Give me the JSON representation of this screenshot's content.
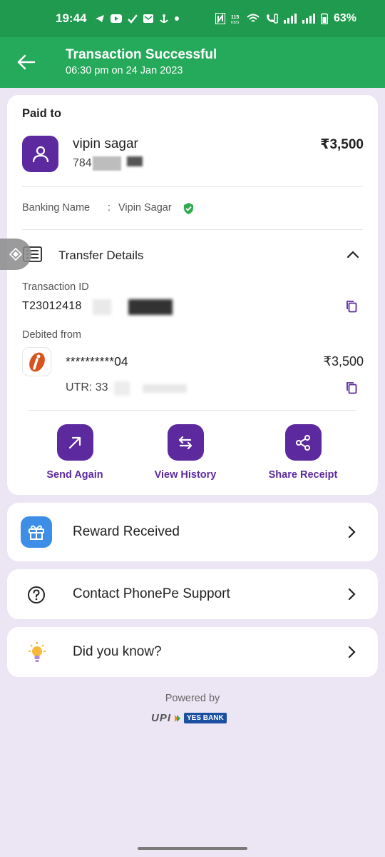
{
  "status_bar": {
    "time": "19:44",
    "battery": "63%",
    "speed": "115 KB/S"
  },
  "header": {
    "title": "Transaction Successful",
    "subtitle": "06:30 pm on 24 Jan 2023"
  },
  "payment": {
    "paid_to_label": "Paid to",
    "payee_name": "vipin sagar",
    "payee_phone": "784",
    "amount": "₹3,500",
    "banking_name_label": "Banking Name",
    "banking_name_sep": ":",
    "banking_name_value": "Vipin  Sagar"
  },
  "transfer": {
    "title": "Transfer Details",
    "txn_id_label": "Transaction ID",
    "txn_id_value": "T23012418",
    "debited_label": "Debited from",
    "account": "**********04",
    "debited_amount": "₹3,500",
    "utr": "UTR: 33"
  },
  "actions": [
    {
      "label": "Send Again"
    },
    {
      "label": "View History"
    },
    {
      "label": "Share Receipt"
    }
  ],
  "rows": [
    {
      "label": "Reward Received"
    },
    {
      "label": "Contact PhonePe Support"
    },
    {
      "label": "Did you know?"
    }
  ],
  "footer": {
    "powered_by": "Powered by",
    "upi": "UPI",
    "bank": "YES BANK"
  },
  "colors": {
    "primary": "#5c2a9e",
    "header_green": "#25a95a",
    "background": "#ece6f4"
  }
}
